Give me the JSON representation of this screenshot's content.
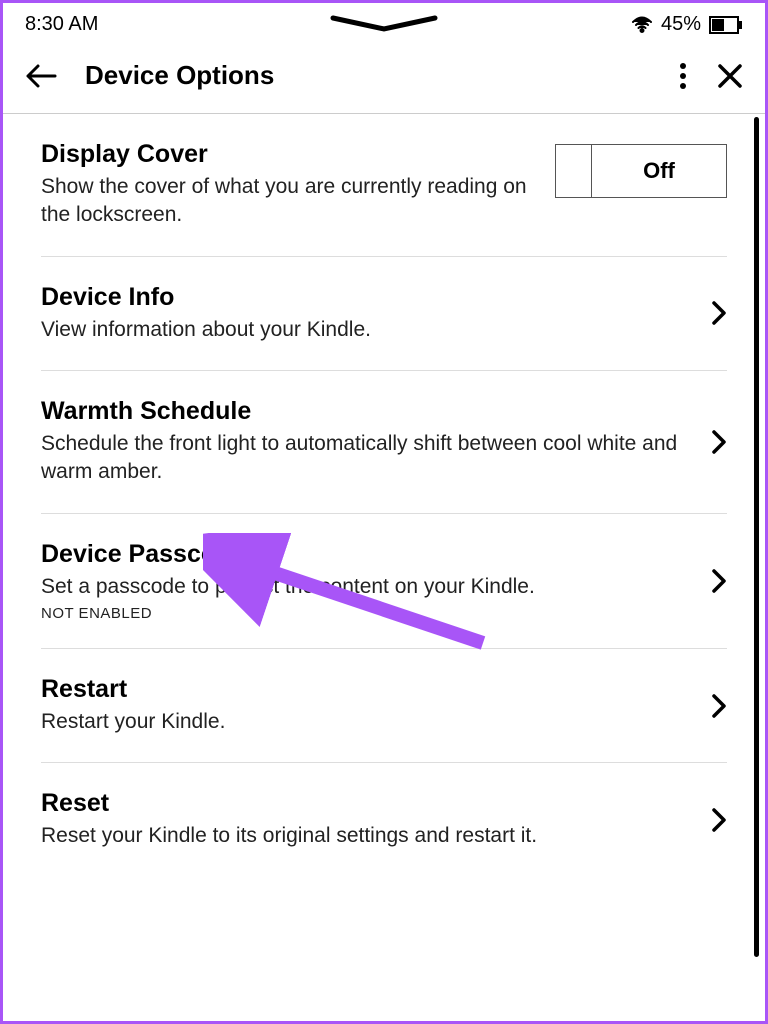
{
  "statusbar": {
    "time": "8:30 AM",
    "battery_percent": "45%"
  },
  "header": {
    "title": "Device Options"
  },
  "toggle": {
    "off_label": "Off"
  },
  "items": [
    {
      "title": "Display Cover",
      "desc": "Show the cover of what you are currently reading on the lockscreen.",
      "type": "toggle"
    },
    {
      "title": "Device Info",
      "desc": "View information about your Kindle.",
      "type": "nav"
    },
    {
      "title": "Warmth Schedule",
      "desc": "Schedule the front light to automatically shift between cool white and warm amber.",
      "type": "nav"
    },
    {
      "title": "Device Passcode",
      "desc": "Set a passcode to protect the content on your Kindle.",
      "status": "NOT ENABLED",
      "type": "nav"
    },
    {
      "title": "Restart",
      "desc": "Restart your Kindle.",
      "type": "nav"
    },
    {
      "title": "Reset",
      "desc": "Reset your Kindle to its original settings and restart it.",
      "type": "nav"
    }
  ]
}
